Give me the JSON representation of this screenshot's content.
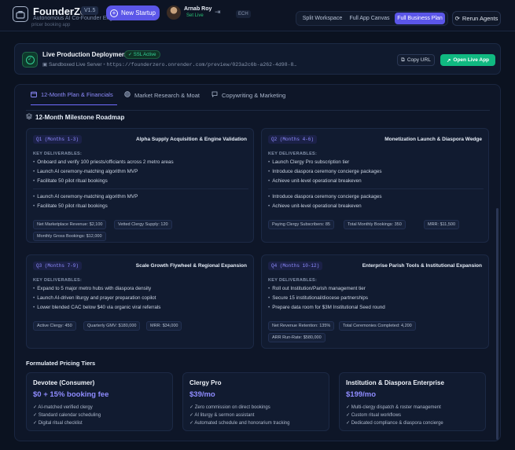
{
  "header": {
    "brand": "FounderZero",
    "version": "V1.5",
    "tagline": "Autonomous AI Co-Founder Engine",
    "new_startup": "New Startup",
    "user_name": "Arnab Roy",
    "user_status": "Set Live",
    "ech_label": "ECH",
    "views": [
      "Split Workspace",
      "Full App Canvas",
      "Full Business Plan"
    ],
    "active_view": "Full Business Plan",
    "rerun": "Rerun Agents",
    "crumb_fragment": "pricer booking app"
  },
  "deployment": {
    "title": "Live Production Deployment",
    "ssl_badge": "SSL Active",
    "server_label": "Sandboxed Live Server",
    "url": "https://founderzero.onrender.com/preview/023a2c6b-a262-4d98-8…",
    "copy_url": "Copy URL",
    "open_live": "Open Live App"
  },
  "tabs": [
    {
      "label": "12-Month Plan & Financials",
      "icon": "calendar-icon",
      "active": true
    },
    {
      "label": "Market Research & Moat",
      "icon": "globe-icon",
      "active": false
    },
    {
      "label": "Copywriting & Marketing",
      "icon": "chat-icon",
      "active": false
    }
  ],
  "roadmap": {
    "title": "12-Month Milestone Roadmap",
    "key_deliverables_label": "KEY DELIVERABLES:",
    "quarters": [
      {
        "tag": "Q1 (Months 1-3)",
        "title": "Alpha Supply Acquisition & Engine Validation",
        "deliverables": [
          "Onboard and verify 100 priests/officiants across 2 metro areas",
          "Launch AI ceremony-matching algorithm MVP",
          "Facilitate 50 pilot ritual bookings"
        ],
        "extra": [
          "Launch AI ceremony-matching algorithm MVP",
          "Facilitate 50 pilot ritual bookings"
        ],
        "metrics": [
          "Net Marketplace Revenue: $2,100",
          "Vetted Clergy Supply: 120",
          "Monthly Gross Bookings: $12,000"
        ]
      },
      {
        "tag": "Q2 (Months 4-6)",
        "title": "Monetization Launch & Diaspora Wedge",
        "deliverables": [
          "Launch Clergy Pro subscription tier",
          "Introduce diaspora ceremony concierge packages",
          "Achieve unit-level operational breakeven"
        ],
        "extra": [
          "Introduce diaspora ceremony concierge packages",
          "Achieve unit-level operational breakeven"
        ],
        "metrics": [
          "Paying Clergy Subscribers: 85",
          "Total Monthly Bookings: 350",
          "MRR: $11,500"
        ]
      },
      {
        "tag": "Q3 (Months 7-9)",
        "title": "Scale Growth Flywheel & Regional Expansion",
        "deliverables": [
          "Expand to 5 major metro hubs with diaspora density",
          "Launch AI-driven liturgy and prayer preparation copilot",
          "Lower blended CAC below $40 via organic viral referrals"
        ],
        "extra": [],
        "metrics": [
          "Active Clergy: 450",
          "Quarterly GMV: $180,000",
          "MRR: $34,000"
        ]
      },
      {
        "tag": "Q4 (Months 10-12)",
        "title": "Enterprise Parish Tools & Institutional Expansion",
        "deliverables": [
          "Roll out Institution/Parish management tier",
          "Secure 15 institutional/diocese partnerships",
          "Prepare data room for $3M Institutional Seed round"
        ],
        "extra": [],
        "metrics": [
          "Net Revenue Retention: 135%",
          "Total Ceremonies Completed: 4,200",
          "ARR Run-Rate: $580,000"
        ]
      }
    ]
  },
  "pricing": {
    "title": "Formulated Pricing Tiers",
    "tiers": [
      {
        "name": "Devotee (Consumer)",
        "price": "$0 + 15% booking fee",
        "features": [
          "AI-matched verified clergy",
          "Standard calendar scheduling",
          "Digital ritual checklist"
        ]
      },
      {
        "name": "Clergy Pro",
        "price": "$39/mo",
        "features": [
          "Zero commission on direct bookings",
          "AI liturgy & sermon assistant",
          "Automated schedule and honorarium tracking"
        ]
      },
      {
        "name": "Institution & Diaspora Enterprise",
        "price": "$199/mo",
        "features": [
          "Multi-clergy dispatch & roster management",
          "Custom ritual workflows",
          "Dedicated compliance & diaspora concierge"
        ]
      }
    ]
  },
  "colors": {
    "accent": "#5b56e8",
    "success": "#10b981",
    "background": "#0b1220"
  }
}
